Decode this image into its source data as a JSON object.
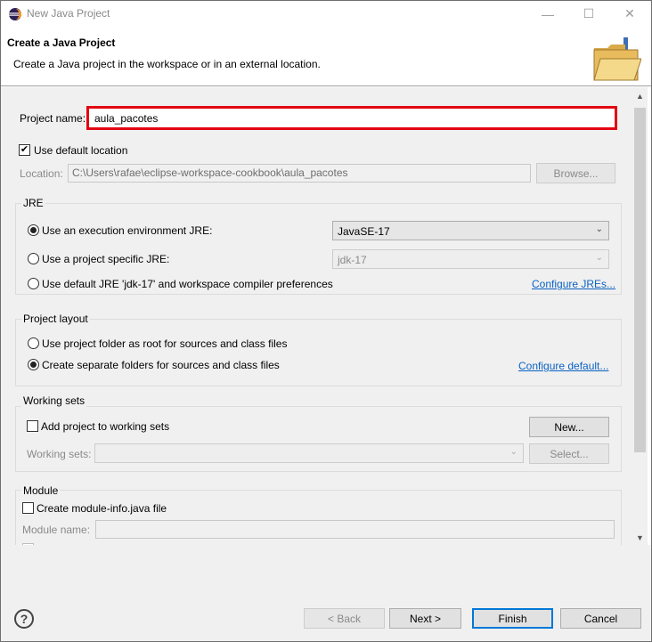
{
  "window": {
    "title": "New Java Project",
    "minimize_glyph": "—",
    "maximize_glyph": "☐",
    "close_glyph": "✕"
  },
  "banner": {
    "title": "Create a Java Project",
    "description": "Create a Java project in the workspace or in an external location.",
    "icon": "folder-with-java-icon"
  },
  "form": {
    "project_name_label": "Project name:",
    "project_name_value": "aula_pacotes",
    "use_default_location_label": "Use default location",
    "use_default_location_checked": true,
    "location_label": "Location:",
    "location_value": "C:\\Users\\rafae\\eclipse-workspace-cookbook\\aula_pacotes",
    "browse_label": "Browse..."
  },
  "jre": {
    "group_title": "JRE",
    "execution_env_label": "Use an execution environment JRE:",
    "execution_env_value": "JavaSE-17",
    "project_specific_label": "Use a project specific JRE:",
    "project_specific_value": "jdk-17",
    "default_jre_label": "Use default JRE 'jdk-17' and workspace compiler preferences",
    "configure_jres_link": "Configure JREs..."
  },
  "project_layout": {
    "group_title": "Project layout",
    "use_project_folder_label": "Use project folder as root for sources and class files",
    "create_separate_label": "Create separate folders for sources and class files",
    "configure_default_link": "Configure default..."
  },
  "working_sets": {
    "group_title": "Working sets",
    "add_project_label": "Add project to working sets",
    "new_button": "New...",
    "working_sets_label": "Working sets:",
    "select_button": "Select..."
  },
  "module": {
    "group_title": "Module",
    "create_module_info_label": "Create module-info.java file",
    "module_name_label": "Module name:"
  },
  "footer": {
    "help_glyph": "?",
    "back_button": "< Back",
    "next_button": "Next >",
    "finish_button": "Finish",
    "cancel_button": "Cancel"
  },
  "scroll": {
    "up_glyph": "▲",
    "down_glyph": "▼"
  },
  "colors": {
    "highlight": "#e30613",
    "link": "#0b62c4",
    "default_button_border": "#0078d7"
  }
}
